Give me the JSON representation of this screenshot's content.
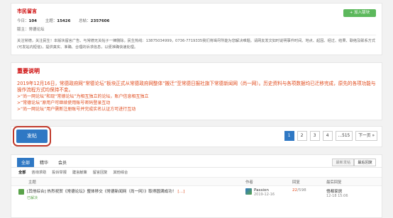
{
  "info": {
    "title": "市民留言",
    "stats": [
      {
        "label": "今日：",
        "value": "104"
      },
      {
        "label": "主题：",
        "value": "15426"
      },
      {
        "label": "总帖：",
        "value": "2357606"
      }
    ],
    "moderator_label": "版主：",
    "moderator_value": "常德论坛",
    "description": "关注常德，关注民生！本版块留言广告、与常德无关帖子一律删除。民生热线：13875034999，0736-7719335我们将竭尽所能为您解决难题。请网友发文如时说明事件时间、地点、起因、经过、结果、联络及联系方式(可发站内短信)，提供真实、准确、合理的诉求信息，以便准确快速处理。",
    "follow_label": "+ 加入版块"
  },
  "notice": {
    "title": "重要说明",
    "main": "2019年12月16日，常德政府网“常德论坛”板块正式从常德政府网整体“搬迁”至常德日报社旗下常德新闻网（尚一网）。历史资料与各项数据均已迁移完成，原先的各项功能与操作流程方式均保持不变。",
    "lines": [
      ">“尚一网论坛”和现“常德论坛”为相互独立的论坛，账户信息相互独立",
      ">“常德论坛”原用户可继续使用账号密码登录互动",
      ">“尚一网论坛”用户需新注册账号并完成实名认证方可进行互动"
    ]
  },
  "toolbar": {
    "post_label": "发帖",
    "pages": [
      "1",
      "2",
      "3",
      "4",
      "...515",
      "下一页 »"
    ]
  },
  "tabs": {
    "main": [
      "全部",
      "精华",
      "会员"
    ],
    "sub": [
      "全部",
      "咨询求助",
      "投诉举报",
      "建言献策",
      "留言回复",
      "其他综合"
    ],
    "sort": [
      "最新发帖",
      "最后回复"
    ]
  },
  "table": {
    "headers": {
      "topic": "主题",
      "author": "作者",
      "reply": "回复",
      "last": "最后回复"
    },
    "rows": [
      {
        "title": "[其他综合] 热烈祝贺《常德论坛》整体移交《常德新闻网（尚一网）》取得圆满成功！",
        "tag": "[…]",
        "meta": "已解决",
        "author": "Passion",
        "date": "2019-12-16",
        "reply_count": "22",
        "reply_total": "/598",
        "last_user": "悟都家居",
        "last_time": "12-18 15:06"
      }
    ]
  }
}
